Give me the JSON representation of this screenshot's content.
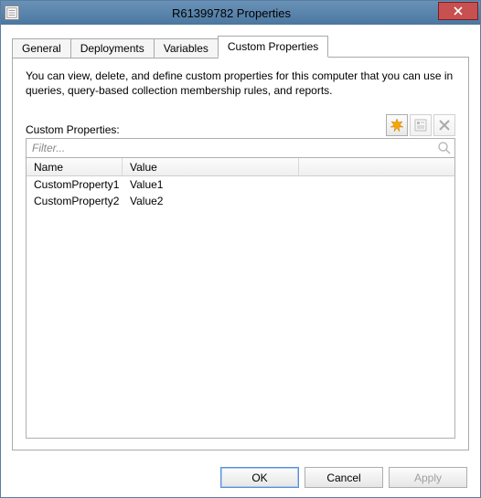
{
  "window": {
    "title": "R61399782 Properties"
  },
  "tabs": {
    "items": [
      {
        "label": "General",
        "active": false
      },
      {
        "label": "Deployments",
        "active": false
      },
      {
        "label": "Variables",
        "active": false
      },
      {
        "label": "Custom Properties",
        "active": true
      }
    ]
  },
  "panel": {
    "description": "You can view, delete, and define custom properties for this computer that you can use in queries, query-based collection membership rules, and reports.",
    "section_label": "Custom Properties:",
    "filter_placeholder": "Filter...",
    "columns": {
      "name": "Name",
      "value": "Value"
    },
    "rows": [
      {
        "name": "CustomProperty1",
        "value": "Value1"
      },
      {
        "name": "CustomProperty2",
        "value": "Value2"
      }
    ]
  },
  "buttons": {
    "ok": "OK",
    "cancel": "Cancel",
    "apply": "Apply"
  }
}
